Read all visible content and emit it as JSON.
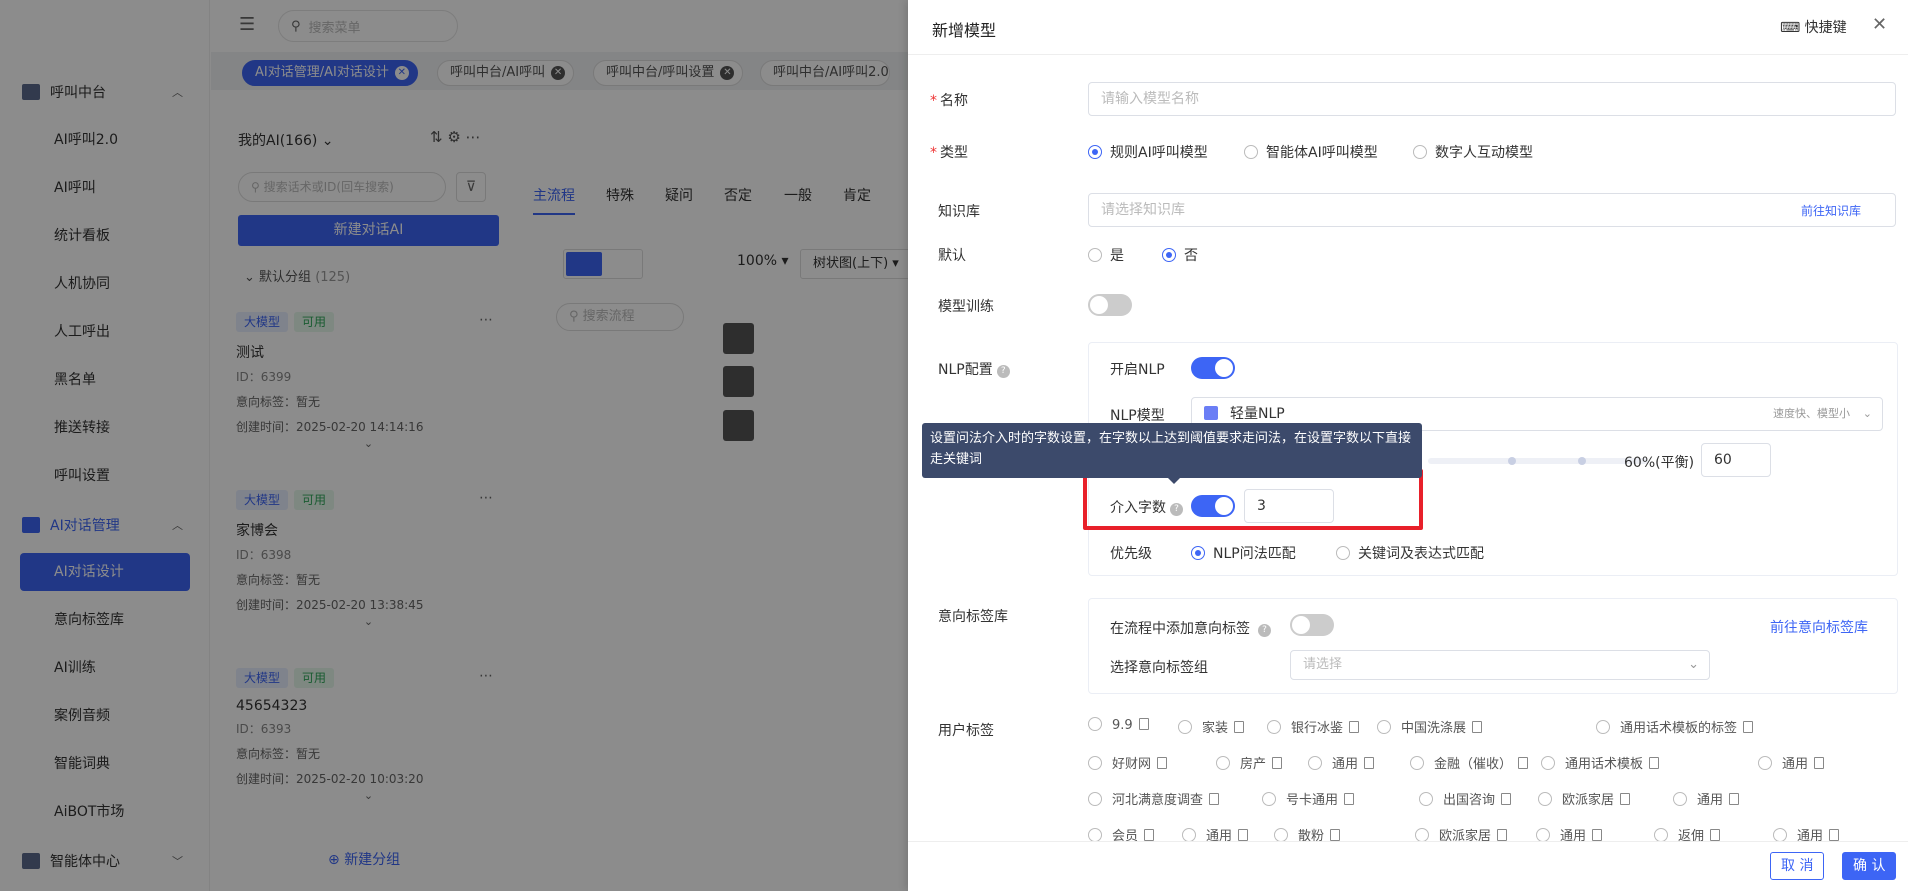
{
  "sidebar": {
    "groups": [
      {
        "label": "呼叫中台"
      },
      {
        "label": "AI对话管理"
      },
      {
        "label": "智能体中心"
      }
    ],
    "items_call": [
      "AI呼叫2.0",
      "AI呼叫",
      "统计看板",
      "人机协同",
      "人工呼出",
      "黑名单",
      "推送转接",
      "呼叫设置"
    ],
    "items_ai": [
      "AI对话设计",
      "意向标签库",
      "AI训练",
      "案例音频",
      "智能词典",
      "AiBOT市场"
    ]
  },
  "topbar": {
    "search_placeholder": "搜索菜单"
  },
  "tabs": [
    "AI对话管理/AI对话设计",
    "呼叫中台/AI呼叫",
    "呼叫中台/呼叫设置",
    "呼叫中台/AI呼叫2.0"
  ],
  "list": {
    "title": "我的AI(166)",
    "search_placeholder": "搜索话术或ID(回车搜索)",
    "new_button": "新建对话AI",
    "group_name": "默认分组",
    "group_count": "(125)",
    "new_group": "新建分组",
    "cards": [
      {
        "badge1": "大模型",
        "badge2": "可用",
        "name": "测试",
        "id": "ID：6399",
        "intent": "意向标签：暂无",
        "created": "创建时间：2025-02-20 14:14:16"
      },
      {
        "badge1": "大模型",
        "badge2": "可用",
        "name": "家博会",
        "id": "ID：6398",
        "intent": "意向标签：暂无",
        "created": "创建时间：2025-02-20 13:38:45"
      },
      {
        "badge1": "大模型",
        "badge2": "可用",
        "name": "45654323",
        "id": "ID：6393",
        "intent": "意向标签：暂无",
        "created": "创建时间：2025-02-20 10:03:20"
      }
    ]
  },
  "flow": {
    "tabs": [
      "主流程",
      "特殊",
      "疑问",
      "否定",
      "一般",
      "肯定"
    ],
    "zoom": "100%",
    "view_mode": "树状图(上下)",
    "search_placeholder": "搜索流程"
  },
  "drawer": {
    "title": "新增模型",
    "shortcut": "快捷键",
    "name_label": "名称",
    "name_placeholder": "请输入模型名称",
    "type_label": "类型",
    "type_options": [
      "规则AI呼叫模型",
      "智能体AI呼叫模型",
      "数字人互动模型"
    ],
    "kb_label": "知识库",
    "kb_placeholder": "请选择知识库",
    "kb_link": "前往知识库",
    "default_label": "默认",
    "default_options": [
      "是",
      "否"
    ],
    "train_label": "模型训练",
    "nlp_label": "NLP配置",
    "nlp_open": "开启NLP",
    "nlp_model_label": "NLP模型",
    "nlp_model_value": "轻量NLP",
    "nlp_model_hint": "速度快、模型小",
    "threshold_text": "60%(平衡)",
    "threshold_value": "60",
    "threshold_fraction": 0.6,
    "tooltip": "设置问法介入时的字数设置，在字数以上达到阈值要求走问法，在设置字数以下直接走关键词",
    "intervene_label": "介入字数",
    "intervene_value": "3",
    "priority_label": "优先级",
    "priority_options": [
      "NLP问法匹配",
      "关键词及表达式匹配"
    ],
    "intent_lib_label": "意向标签库",
    "intent_add": "在流程中添加意向标签",
    "intent_link": "前往意向标签库",
    "intent_group_label": "选择意向标签组",
    "intent_group_placeholder": "请选择",
    "user_tags_label": "用户标签",
    "user_tags": [
      [
        "9.9",
        "家装",
        "银行冰鉴",
        "中国洗涤展",
        "通用话术模板的标签"
      ],
      [
        "好财网",
        "房产",
        "通用",
        "金融（催收）",
        "通用话术模板",
        "通用"
      ],
      [
        "河北满意度调查",
        "号卡通用",
        "出国咨询",
        "欧派家居",
        "通用"
      ],
      [
        "会员",
        "通用",
        "散粉",
        "欧派家居",
        "通用",
        "返佣",
        "通用"
      ]
    ],
    "cancel": "取 消",
    "confirm": "确 认"
  },
  "colors": {
    "accent": "#3d65f5",
    "highlight": "#e8202a",
    "tooltip_bg": "#3c4a6b"
  }
}
